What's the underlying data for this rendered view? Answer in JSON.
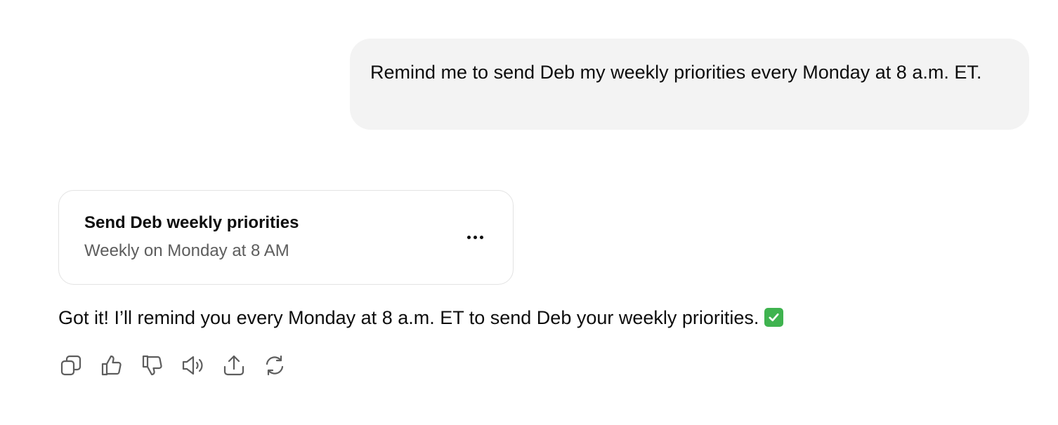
{
  "user_message": {
    "text": "Remind me to send Deb my weekly priorities every Monday at 8 a.m. ET."
  },
  "task_card": {
    "title": "Send Deb weekly priorities",
    "schedule": "Weekly on Monday at 8 AM",
    "menu_icon": "more-horizontal-icon"
  },
  "assistant_message": {
    "text": "Got it! I’ll remind you every Monday at 8 a.m. ET to send Deb your weekly priorities.",
    "emoji": "check-mark-button-icon"
  },
  "actions": [
    {
      "name": "copy",
      "icon": "copy-icon"
    },
    {
      "name": "good-response",
      "icon": "thumbs-up-icon"
    },
    {
      "name": "bad-response",
      "icon": "thumbs-down-icon"
    },
    {
      "name": "read-aloud",
      "icon": "speaker-icon"
    },
    {
      "name": "share",
      "icon": "share-icon"
    },
    {
      "name": "regenerate",
      "icon": "refresh-icon"
    }
  ],
  "colors": {
    "user_bubble_bg": "#f3f3f3",
    "text_primary": "#0d0d0d",
    "text_secondary": "#5d5d5d",
    "card_border": "#e3e3e3",
    "check_green": "#3fb34f"
  }
}
